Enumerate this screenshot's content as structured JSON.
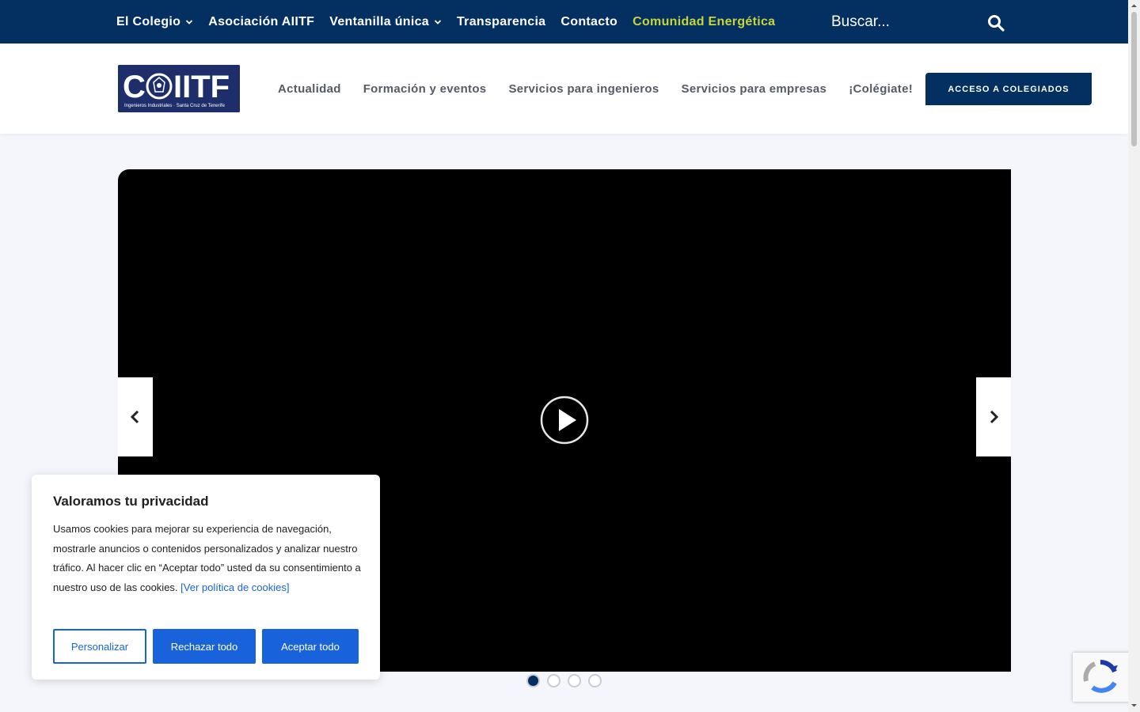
{
  "topbar": {
    "items": [
      {
        "label": "El Colegio",
        "has_dropdown": true
      },
      {
        "label": "Asociación AIITF",
        "has_dropdown": false
      },
      {
        "label": "Ventanilla única",
        "has_dropdown": true
      },
      {
        "label": "Transparencia",
        "has_dropdown": false
      },
      {
        "label": "Contacto",
        "has_dropdown": false
      },
      {
        "label": "Comunidad Energética",
        "has_dropdown": false
      }
    ],
    "search_placeholder": "Buscar..."
  },
  "header": {
    "logo_text": "COIITF",
    "logo_subtitle": "Ingenieros Industriales · Santa Cruz de Tenerife",
    "nav": [
      "Actualidad",
      "Formación y eventos",
      "Servicios para ingenieros",
      "Servicios para empresas",
      "¡Colégiate!"
    ],
    "access_button": "ACCESO A COLEGIADOS"
  },
  "slider": {
    "active_slide": 1,
    "slide_count": 4
  },
  "cookie": {
    "title": "Valoramos tu privacidad",
    "body": "Usamos cookies para mejorar su experiencia de navegación, mostrarle anuncios o contenidos personalizados y analizar nuestro tráfico. Al hacer clic en “Aceptar todo” usted da su consentimiento a nuestro uso de las cookies.",
    "link": "[Ver política de cookies]",
    "customize": "Personalizar",
    "reject": "Rechazar todo",
    "accept": "Aceptar todo"
  },
  "colors": {
    "brand_navy": "#033061",
    "accent_green": "#c6d63a",
    "cookie_blue": "#1863dc",
    "logo_bg": "#1d2e6a"
  }
}
